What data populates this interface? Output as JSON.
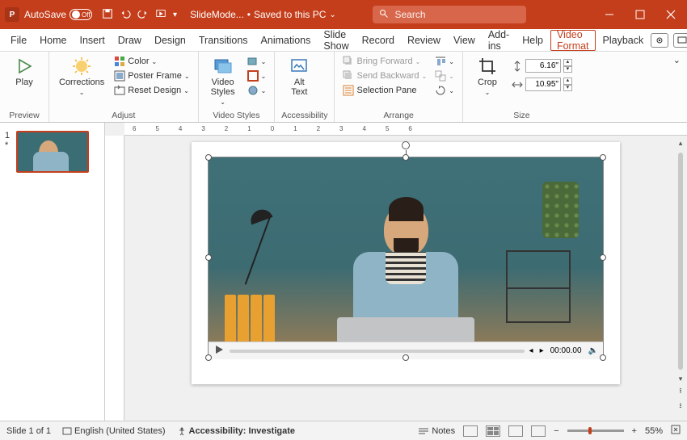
{
  "titlebar": {
    "autosave_label": "AutoSave",
    "autosave_state": "Off",
    "doc_name": "SlideMode...",
    "save_status": "Saved to this PC",
    "search_placeholder": "Search"
  },
  "menu": {
    "tabs": [
      "File",
      "Home",
      "Insert",
      "Draw",
      "Design",
      "Transitions",
      "Animations",
      "Slide Show",
      "Record",
      "Review",
      "View",
      "Add-ins",
      "Help",
      "Video Format",
      "Playback"
    ],
    "active": "Video Format"
  },
  "ribbon": {
    "preview": {
      "play": "Play",
      "label": "Preview"
    },
    "adjust": {
      "corrections": "Corrections",
      "color": "Color",
      "poster": "Poster Frame",
      "reset": "Reset Design",
      "label": "Adjust"
    },
    "video_styles": {
      "styles": "Video\nStyles",
      "label": "Video Styles"
    },
    "accessibility": {
      "alt": "Alt\nText",
      "label": "Accessibility"
    },
    "arrange": {
      "bring": "Bring Forward",
      "send": "Send Backward",
      "pane": "Selection Pane",
      "label": "Arrange"
    },
    "size": {
      "crop": "Crop",
      "height": "6.16\"",
      "width": "10.95\"",
      "label": "Size"
    }
  },
  "thumbs": {
    "slide1_num": "1",
    "slide1_star": "*"
  },
  "video_player": {
    "time": "00:00.00"
  },
  "statusbar": {
    "slide": "Slide 1 of 1",
    "lang": "English (United States)",
    "access": "Accessibility: Investigate",
    "notes": "Notes",
    "zoom": "55%"
  }
}
